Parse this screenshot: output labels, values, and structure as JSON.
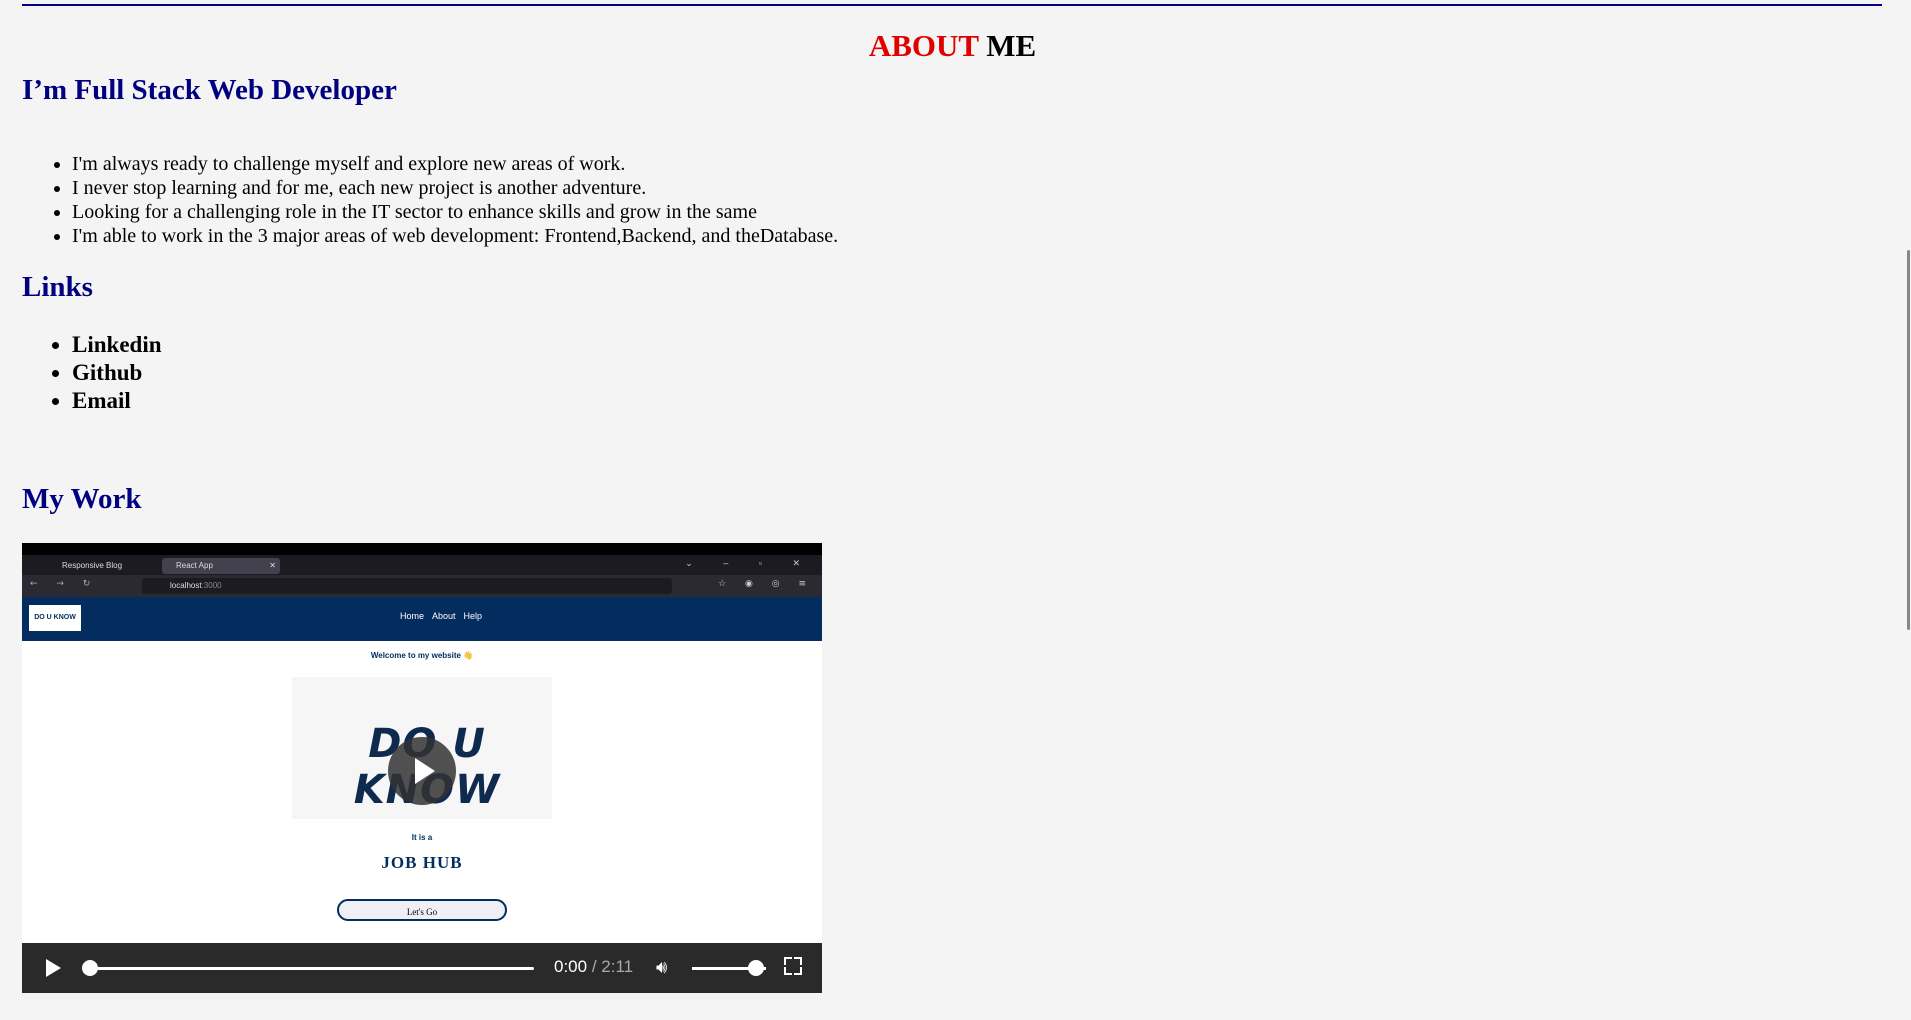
{
  "header": {
    "title_red": "ABOUT",
    "title_black": "ME"
  },
  "intro": {
    "heading": "I’m Full Stack Web Developer",
    "bullets": [
      "I'm always ready to challenge myself and explore new areas of work.",
      "I never stop learning and for me, each new project is another adventure.",
      "Looking for a challenging role in the IT sector to enhance skills and grow in the same",
      "I'm able to work in the 3 major areas of web development: Frontend,Backend, and theDatabase."
    ]
  },
  "links": {
    "heading": "Links",
    "items": [
      "Linkedin",
      "Github",
      "Email"
    ]
  },
  "work": {
    "heading": "My Work",
    "video": {
      "tab1": "Responsive Blog",
      "tab2": "React App",
      "url_host": "localhost",
      "url_port": ":3000",
      "site_logo": "DO U KNOW",
      "site_nav": [
        "Home",
        "About",
        "Help"
      ],
      "welcome": "Welcome to my website 👋",
      "hero_text": "DO U KNOW",
      "it_is": "It is a",
      "job_hub": "JOB HUB",
      "cta": "Let's Go",
      "time_current": "0:00",
      "time_duration": "/ 2:11",
      "progress": 0,
      "volume": 0.9
    }
  },
  "colors": {
    "accent_red": "#e00000",
    "heading_navy": "#000080",
    "site_navy": "#022d5e",
    "background": "#f4f4f4"
  }
}
